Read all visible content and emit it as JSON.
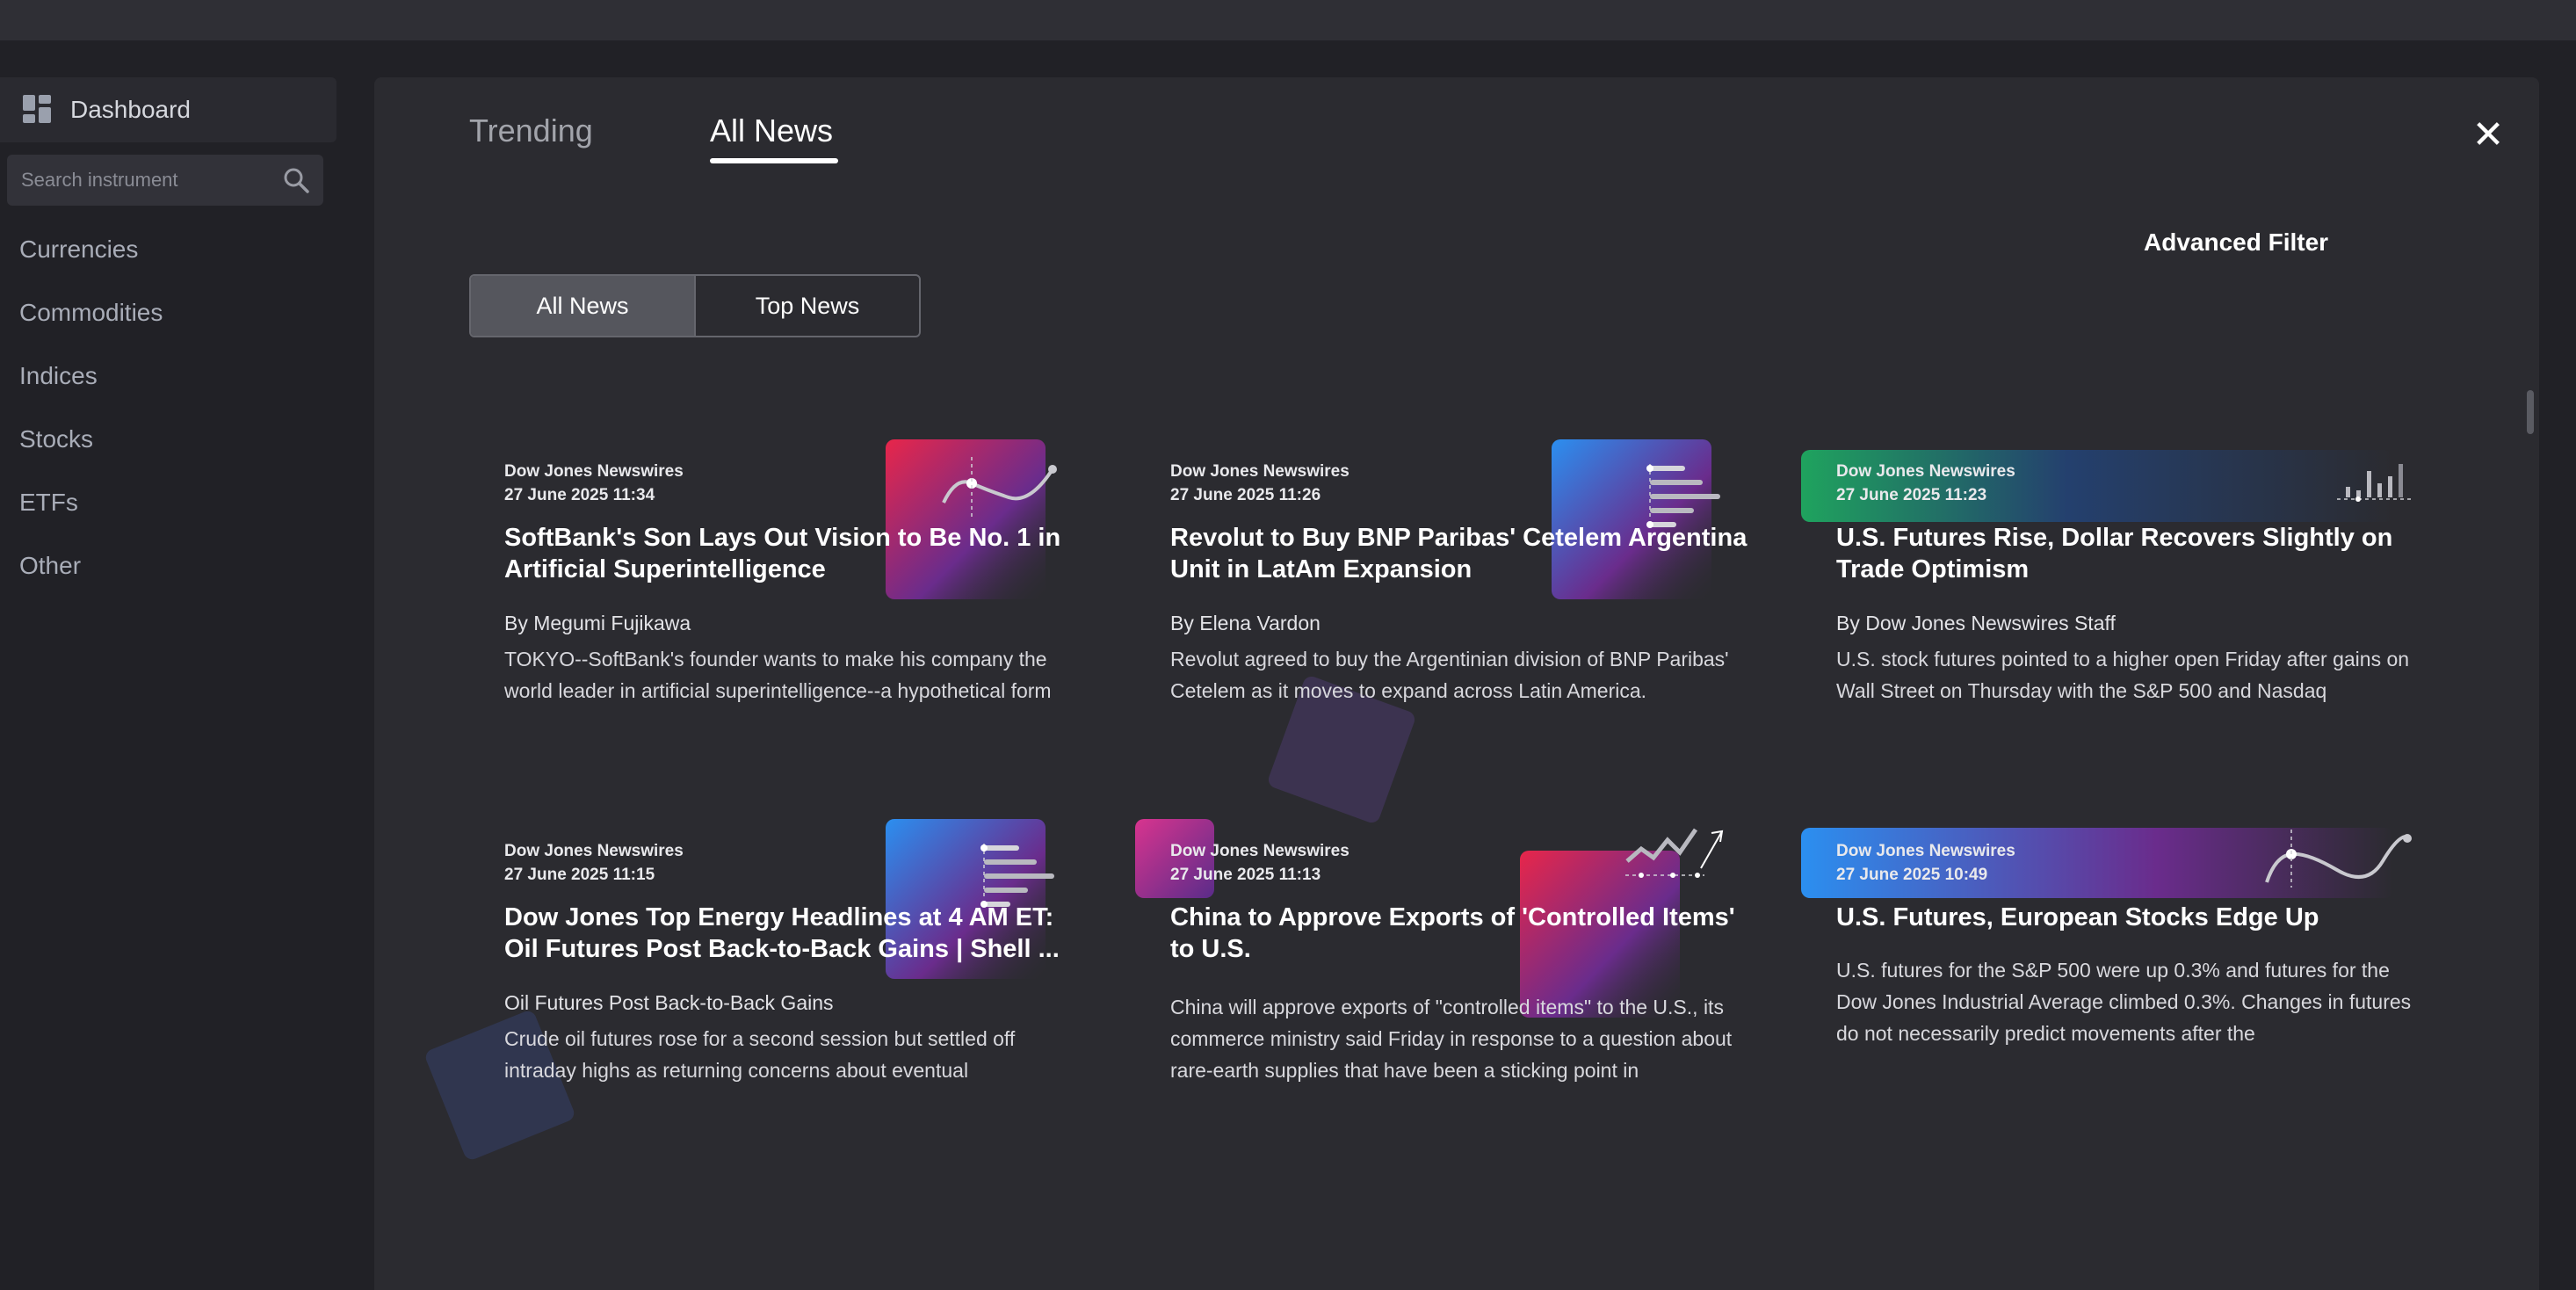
{
  "sidebar": {
    "dashboard_label": "Dashboard",
    "search_placeholder": "Search instrument",
    "nav": [
      "Currencies",
      "Commodities",
      "Indices",
      "Stocks",
      "ETFs",
      "Other"
    ]
  },
  "tabs": {
    "trending": "Trending",
    "all_news": "All News"
  },
  "advanced_filter": "Advanced Filter",
  "toggle": {
    "all_news": "All News",
    "top_news": "Top News"
  },
  "cards": [
    {
      "source": "Dow Jones Newswires",
      "date": "27 June 2025 11:34",
      "title": "SoftBank's Son Lays Out Vision to Be No. 1 in Artificial Superintelligence",
      "byline": "By Megumi Fujikawa",
      "body": "TOKYO--SoftBank's founder wants to make his company the world leader in artificial superintelligence--a hypothetical form"
    },
    {
      "source": "Dow Jones Newswires",
      "date": "27 June 2025 11:26",
      "title": "Revolut to Buy BNP Paribas' Cetelem Argentina Unit in LatAm Expansion",
      "byline": "By Elena Vardon",
      "body": "Revolut agreed to buy the Argentinian division of BNP Paribas' Cetelem as it moves to expand across Latin America."
    },
    {
      "source": "Dow Jones Newswires",
      "date": "27 June 2025 11:23",
      "title": "U.S. Futures Rise, Dollar Recovers Slightly on Trade Optimism",
      "byline": "By Dow Jones Newswires Staff",
      "body": "U.S. stock futures pointed to a higher open Friday after gains on Wall Street on Thursday with the S&P 500 and Nasdaq"
    },
    {
      "source": "Dow Jones Newswires",
      "date": "27 June 2025 11:15",
      "title": "Dow Jones Top Energy Headlines at 4 AM ET: Oil Futures Post Back-to-Back Gains | Shell ...",
      "byline": "Oil Futures Post Back-to-Back Gains",
      "body": "Crude oil futures rose for a second session but settled off intraday highs as returning concerns about eventual"
    },
    {
      "source": "Dow Jones Newswires",
      "date": "27 June 2025 11:13",
      "title": "China to Approve Exports of 'Controlled Items' to U.S.",
      "byline": "",
      "body": "China will approve exports of \"controlled items\" to the U.S., its commerce ministry said Friday in response to a question about rare-earth supplies that have been a sticking point in"
    },
    {
      "source": "Dow Jones Newswires",
      "date": "27 June 2025 10:49",
      "title": "U.S. Futures, European Stocks Edge Up",
      "byline": "",
      "body": "U.S. futures for the S&P 500 were up 0.3% and futures for the Dow Jones Industrial Average climbed 0.3%. Changes in futures do not necessarily predict movements after the"
    }
  ]
}
